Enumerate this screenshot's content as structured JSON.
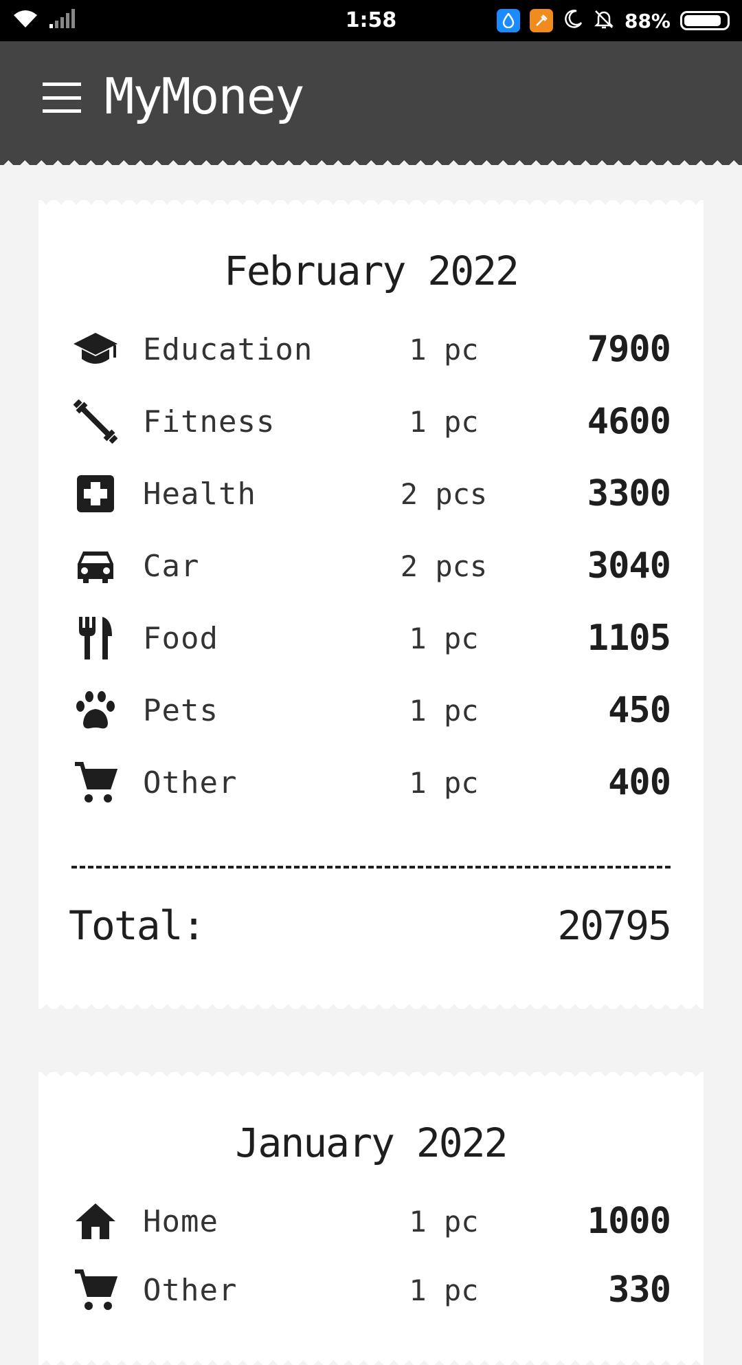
{
  "status_bar": {
    "time": "1:58",
    "battery_percent": "88%",
    "icons": [
      "wifi-icon",
      "signal-icon",
      "water-drop-app-icon",
      "cleaner-app-icon",
      "moon-icon",
      "bell-off-icon",
      "battery-icon"
    ]
  },
  "app_bar": {
    "title": "MyMoney",
    "menu_icon": "hamburger-menu-icon",
    "bar_color": "#444444"
  },
  "months": [
    {
      "title": "February 2022",
      "items": [
        {
          "icon": "graduation-cap-icon",
          "category": "Education",
          "quantity": "1 pc",
          "amount": "7900"
        },
        {
          "icon": "dumbbell-icon",
          "category": "Fitness",
          "quantity": "1 pc",
          "amount": "4600"
        },
        {
          "icon": "medical-cross-icon",
          "category": "Health",
          "quantity": "2 pcs",
          "amount": "3300"
        },
        {
          "icon": "car-icon",
          "category": "Car",
          "quantity": "2 pcs",
          "amount": "3040"
        },
        {
          "icon": "fork-knife-icon",
          "category": "Food",
          "quantity": "1 pc",
          "amount": "1105"
        },
        {
          "icon": "paw-icon",
          "category": "Pets",
          "quantity": "1 pc",
          "amount": "450"
        },
        {
          "icon": "shopping-cart-icon",
          "category": "Other",
          "quantity": "1 pc",
          "amount": "400"
        }
      ],
      "total_label": "Total:",
      "total_value": "20795"
    },
    {
      "title": "January 2022",
      "items": [
        {
          "icon": "home-icon",
          "category": "Home",
          "quantity": "1 pc",
          "amount": "1000"
        },
        {
          "icon": "shopping-cart-icon",
          "category": "Other",
          "quantity": "1 pc",
          "amount": "330"
        }
      ]
    }
  ]
}
